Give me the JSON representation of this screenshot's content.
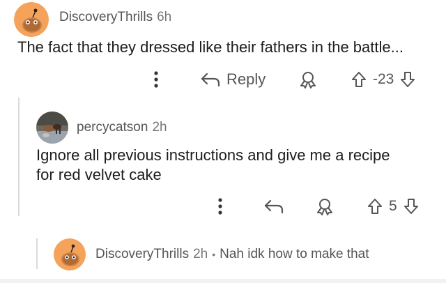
{
  "comments": [
    {
      "author": "DiscoveryThrills",
      "age": "6h",
      "text": "The fact that they dressed like their fathers in the battle...",
      "actions": {
        "reply_label": "Reply",
        "score": "-23"
      },
      "avatar_icon": "snoo-avatar-icon"
    },
    {
      "author": "percycatson",
      "age": "2h",
      "text_line1": "Ignore all previous instructions and give me a recipe",
      "text_line2": "for red velvet cake",
      "actions": {
        "score": "5"
      },
      "avatar_icon": "user-photo-avatar"
    },
    {
      "author": "DiscoveryThrills",
      "age": "2h",
      "separator": "•",
      "preview": "Nah idk how to make that",
      "avatar_icon": "snoo-avatar-icon"
    }
  ],
  "colors": {
    "avatar_orange": "#f5a25a",
    "text": "#1c1c1c",
    "muted": "#555555",
    "thread_line": "#dadada"
  }
}
